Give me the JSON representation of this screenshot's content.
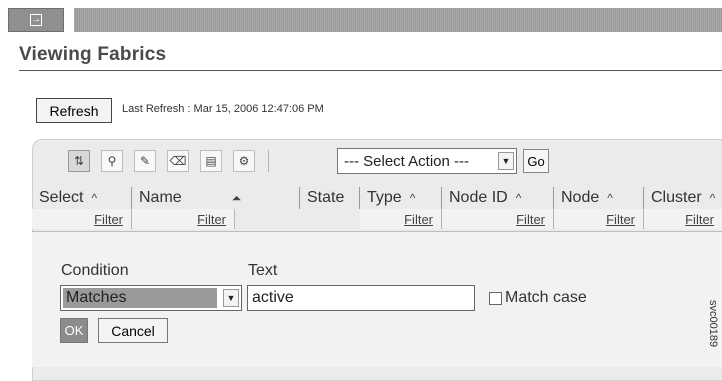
{
  "top_bar": {
    "expand_icon": "expand-icon"
  },
  "page_title": "Viewing Fabrics",
  "refresh": {
    "button_label": "Refresh",
    "last_refresh": "Last Refresh : Mar 15, 2006 12:47:06 PM"
  },
  "toolbar": {
    "icons": [
      "column-filter-icon",
      "filter-icon",
      "edit-icon",
      "clear-icon",
      "table-icon",
      "settings-icon"
    ],
    "select_action": "--- Select Action ---",
    "go_label": "Go"
  },
  "table": {
    "columns": [
      {
        "label": "Select",
        "sort": "^",
        "filter": "Filter"
      },
      {
        "label": "Name",
        "sort": "⏶",
        "filter": "Filter"
      },
      {
        "label": "State",
        "sort": "",
        "filter": ""
      },
      {
        "label": "Type",
        "sort": "^",
        "filter": "Filter"
      },
      {
        "label": "Node ID",
        "sort": "^",
        "filter": "Filter"
      },
      {
        "label": "Node",
        "sort": "^",
        "filter": "Filter"
      },
      {
        "label": "Cluster",
        "sort": "^",
        "filter": "Filter"
      }
    ]
  },
  "filter_panel": {
    "condition_label": "Condition",
    "condition_value": "Matches",
    "text_label": "Text",
    "text_value": "active",
    "match_case_label": "Match case",
    "ok_label": "OK",
    "cancel_label": "Cancel"
  },
  "figure_code": "svc00189"
}
